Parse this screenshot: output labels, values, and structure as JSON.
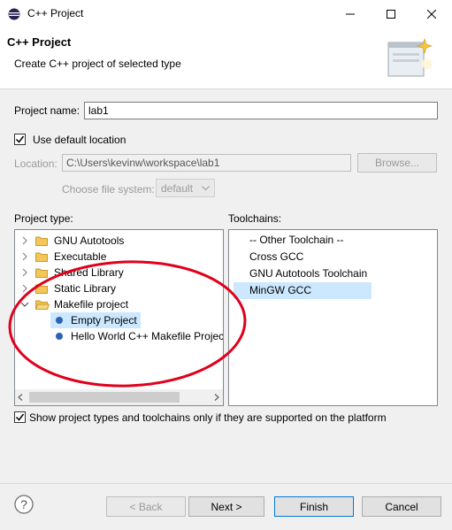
{
  "window": {
    "title": "C++ Project",
    "minimize_label": "—",
    "maximize_label": "☐",
    "close_label": "✕"
  },
  "header": {
    "title": "C++ Project",
    "description": "Create C++ project of selected type",
    "banner_icon": "new-project-wizard-icon"
  },
  "form": {
    "project_name_label": "Project name:",
    "project_name_value": "lab1",
    "use_default_location_label": "Use default location",
    "use_default_location_checked": true,
    "location_label": "Location:",
    "location_value": "C:\\Users\\kevinw\\workspace\\lab1",
    "browse_label": "Browse...",
    "choose_fs_label": "Choose file system:",
    "choose_fs_value": "default"
  },
  "project_type": {
    "label": "Project type:",
    "items": [
      {
        "label": "GNU Autotools",
        "kind": "folder",
        "expanded": false
      },
      {
        "label": "Executable",
        "kind": "folder",
        "expanded": false
      },
      {
        "label": "Shared Library",
        "kind": "folder",
        "expanded": false
      },
      {
        "label": "Static Library",
        "kind": "folder",
        "expanded": false
      },
      {
        "label": "Makefile project",
        "kind": "folder",
        "expanded": true
      },
      {
        "label": "Empty Project",
        "kind": "leaf",
        "selected": true
      },
      {
        "label": "Hello World C++ Makefile Project",
        "kind": "leaf",
        "selected": false
      }
    ]
  },
  "toolchains": {
    "label": "Toolchains:",
    "items": [
      {
        "label": "-- Other Toolchain --",
        "selected": false
      },
      {
        "label": "Cross GCC",
        "selected": false
      },
      {
        "label": "GNU Autotools Toolchain",
        "selected": false
      },
      {
        "label": "MinGW GCC",
        "selected": true
      }
    ]
  },
  "filter": {
    "label": "Show project types and toolchains only if they are supported on the platform",
    "checked": true
  },
  "buttons": {
    "back": "< Back",
    "next": "Next >",
    "finish": "Finish",
    "cancel": "Cancel"
  },
  "colors": {
    "selection": "#cce8ff",
    "annotation_ellipse": "#e0001b",
    "folder": "#e8b84a"
  }
}
